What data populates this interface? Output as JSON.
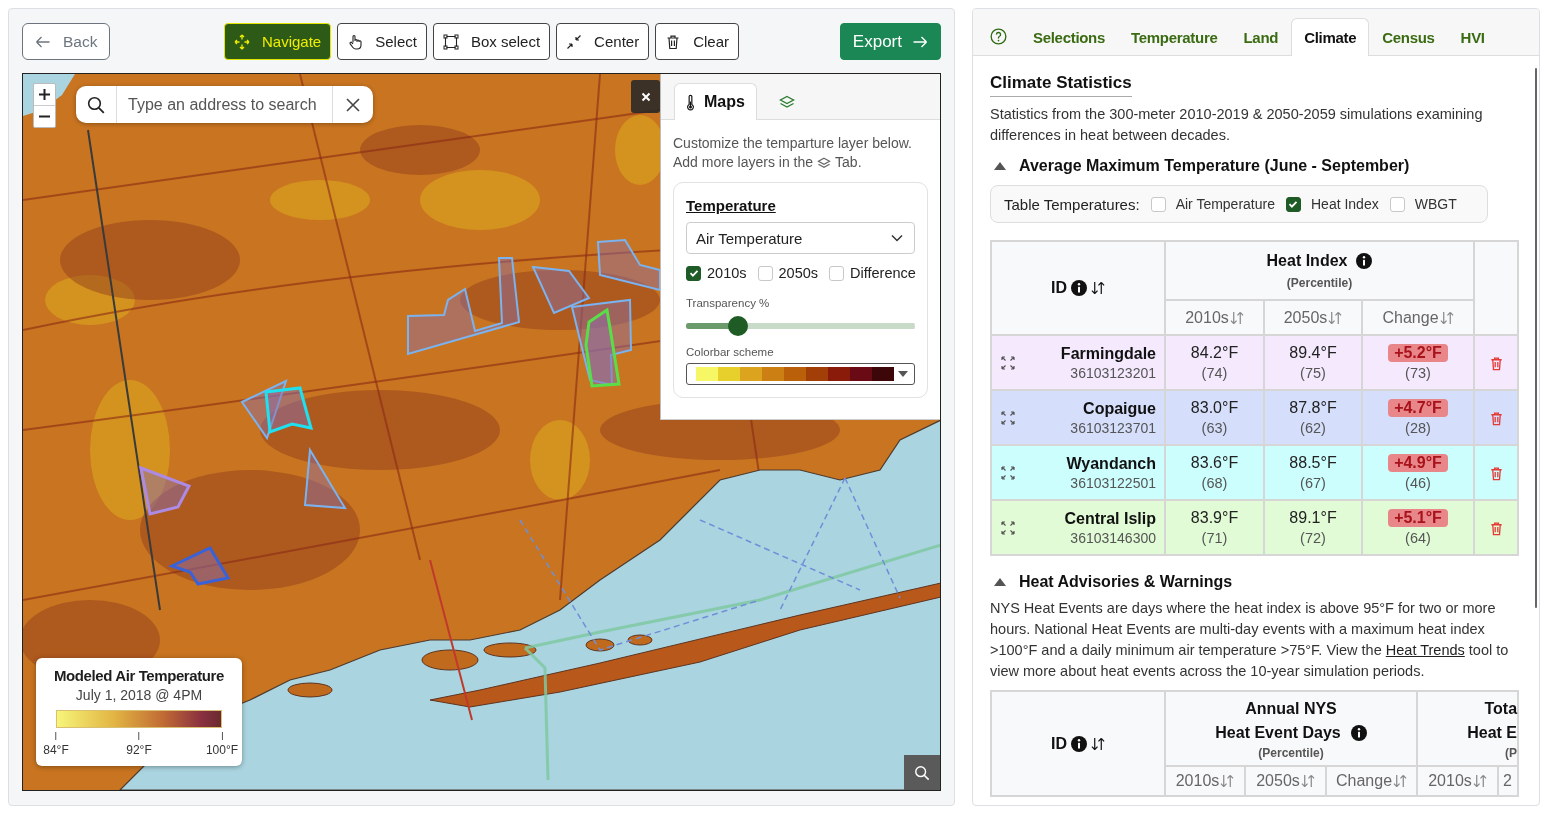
{
  "toolbar": {
    "back": "Back",
    "tools": [
      {
        "label": "Navigate",
        "selected": true
      },
      {
        "label": "Select",
        "selected": false
      },
      {
        "label": "Box select",
        "selected": false
      },
      {
        "label": "Center",
        "selected": false
      },
      {
        "label": "Clear",
        "selected": false
      }
    ],
    "export": "Export"
  },
  "map": {
    "search": {
      "placeholder": "Type an address to search"
    },
    "selections": [
      {
        "color": "#ad8ae4"
      },
      {
        "color": "#3a62d8"
      },
      {
        "color": "#1fe0ee"
      },
      {
        "color": "#5ade48"
      }
    ],
    "legend": {
      "title": "Modeled Air Temperature",
      "subtitle": "July 1, 2018 @ 4PM",
      "ticks": [
        "84°F",
        "92°F",
        "100°F"
      ]
    }
  },
  "layer_panel": {
    "tabs": [
      {
        "kind": "maps",
        "label": "Maps",
        "selected": true
      },
      {
        "kind": "layers",
        "selected": false
      }
    ],
    "intro": "Customize the temparture layer below.",
    "hint_before": "Add more layers in the",
    "hint_after": "Tab.",
    "card": {
      "title": "Temperature",
      "dropdown": "Air Temperature",
      "periods": [
        {
          "label": "2010s",
          "checked": true
        },
        {
          "label": "2050s",
          "checked": false
        },
        {
          "label": "Difference",
          "checked": false
        }
      ],
      "transparency": {
        "label": "Transparency %",
        "level": 0.2
      },
      "colorbar": {
        "label": "Colorbar scheme",
        "swatches": [
          {
            "color": "#f7f766"
          },
          {
            "color": "#e8d02c"
          },
          {
            "color": "#dca41e"
          },
          {
            "color": "#cc8014"
          },
          {
            "color": "#bb600a"
          },
          {
            "color": "#a23e08"
          },
          {
            "color": "#8a1a0a"
          },
          {
            "color": "#6a0a14"
          },
          {
            "color": "#3d0608"
          }
        ]
      }
    }
  },
  "tabs": [
    {
      "label": "Selections",
      "selected": false
    },
    {
      "label": "Temperature",
      "selected": false
    },
    {
      "label": "Land",
      "selected": false
    },
    {
      "label": "Climate",
      "selected": true
    },
    {
      "label": "Census",
      "selected": false
    },
    {
      "label": "HVI",
      "selected": false
    }
  ],
  "climate": {
    "title": "Climate Statistics",
    "description": "Statistics from the 300-meter 2010-2019 & 2050-2059 simulations examining differences in heat between decades.",
    "avg_max": {
      "title": "Average Maximum Temperature (June - September)",
      "expanded": true,
      "filter": {
        "label": "Table Temperatures:",
        "options": [
          {
            "label": "Air Temperature",
            "checked": false
          },
          {
            "label": "Heat Index",
            "checked": true
          },
          {
            "label": "WBGT",
            "checked": false
          }
        ]
      },
      "table": {
        "id_header": "ID",
        "group": {
          "title": "Heat Index",
          "subtitle": "(Percentile)"
        },
        "columns": [
          "2010s",
          "2050s",
          "Change"
        ],
        "rows": [
          {
            "name": "Farmingdale",
            "id": "36103123201",
            "color": "#f4e9fd",
            "cells": [
              {
                "kind": "plain",
                "value": "84.2°F",
                "percentile": "(74)"
              },
              {
                "kind": "plain",
                "value": "89.4°F",
                "percentile": "(75)"
              },
              {
                "kind": "badge",
                "value": "+5.2°F",
                "percentile": "(73)"
              }
            ]
          },
          {
            "name": "Copaigue",
            "id": "36103123701",
            "color": "#d5defa",
            "cells": [
              {
                "kind": "plain",
                "value": "83.0°F",
                "percentile": "(63)"
              },
              {
                "kind": "plain",
                "value": "87.8°F",
                "percentile": "(62)"
              },
              {
                "kind": "badge",
                "value": "+4.7°F",
                "percentile": "(28)"
              }
            ]
          },
          {
            "name": "Wyandanch",
            "id": "36103122501",
            "color": "#cdfefe",
            "cells": [
              {
                "kind": "plain",
                "value": "83.6°F",
                "percentile": "(68)"
              },
              {
                "kind": "plain",
                "value": "88.5°F",
                "percentile": "(67)"
              },
              {
                "kind": "badge",
                "value": "+4.9°F",
                "percentile": "(46)"
              }
            ]
          },
          {
            "name": "Central Islip",
            "id": "36103146300",
            "color": "#e0fbd5",
            "cells": [
              {
                "kind": "plain",
                "value": "83.9°F",
                "percentile": "(71)"
              },
              {
                "kind": "plain",
                "value": "89.1°F",
                "percentile": "(72)"
              },
              {
                "kind": "badge",
                "value": "+5.1°F",
                "percentile": "(64)"
              }
            ]
          }
        ]
      }
    },
    "heat_advisories": {
      "title": "Heat Advisories & Warnings",
      "expanded": true,
      "description": [
        {
          "kind": "text",
          "text": "NYS Heat Events are days where the heat index is above 95°F for two or more hours. National Heat Events are multi-day events with a maximum heat index >100°F and a daily minimum air temperature >75°F. View the "
        },
        {
          "kind": "link",
          "text": "Heat Trends"
        },
        {
          "kind": "text",
          "text": " tool to view more about heat events across the 10-year simulation periods."
        }
      ],
      "table": {
        "id_header": "ID",
        "groups": [
          {
            "lines": [
              "Annual NYS",
              "Heat Event Days"
            ],
            "info": true,
            "subtitle": "(Percentile)"
          },
          {
            "lines": [
              "Tota",
              "Heat E"
            ],
            "info": false,
            "subtitle": "(P"
          }
        ],
        "columns": [
          {
            "label": "2010s",
            "sortable": true
          },
          {
            "label": "2050s",
            "sortable": true
          },
          {
            "label": "Change",
            "sortable": true
          },
          {
            "label": "2010s",
            "sortable": true
          },
          {
            "label": "2",
            "sortable": false
          }
        ]
      }
    }
  }
}
